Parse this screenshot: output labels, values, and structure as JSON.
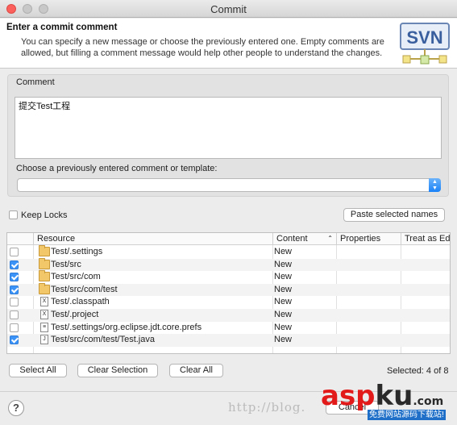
{
  "window": {
    "title": "Commit"
  },
  "header": {
    "title": "Enter a commit comment",
    "description": "You can specify a new message or choose the previously entered one. Empty comments are allowed, but filling a comment message would help other people to understand the changes.",
    "logo_text": "SVN"
  },
  "comment": {
    "label": "Comment",
    "value": "提交Test工程",
    "template_label": "Choose a previously entered comment or template:",
    "template_value": ""
  },
  "options": {
    "keep_locks_label": "Keep Locks",
    "keep_locks_checked": false,
    "paste_button": "Paste selected names"
  },
  "table": {
    "columns": [
      "Resource",
      "Content",
      "Properties",
      "Treat as Edit"
    ],
    "rows": [
      {
        "checked": false,
        "icon": "folder-icon",
        "resource": "Test/.settings",
        "content": "New"
      },
      {
        "checked": true,
        "icon": "folder-icon",
        "resource": "Test/src",
        "content": "New"
      },
      {
        "checked": true,
        "icon": "folder-icon",
        "resource": "Test/src/com",
        "content": "New"
      },
      {
        "checked": true,
        "icon": "folder-icon",
        "resource": "Test/src/com/test",
        "content": "New"
      },
      {
        "checked": false,
        "icon": "xml-file-icon",
        "resource": "Test/.classpath",
        "content": "New"
      },
      {
        "checked": false,
        "icon": "xml-file-icon",
        "resource": "Test/.project",
        "content": "New"
      },
      {
        "checked": false,
        "icon": "text-file-icon",
        "resource": "Test/.settings/org.eclipse.jdt.core.prefs",
        "content": "New"
      },
      {
        "checked": true,
        "icon": "java-file-icon",
        "resource": "Test/src/com/test/Test.java",
        "content": "New"
      }
    ]
  },
  "footer": {
    "select_all": "Select All",
    "clear_selection": "Clear Selection",
    "clear_all": "Clear All",
    "selected_count": "Selected: 4 of 8",
    "help": "?",
    "cancel": "Cancel"
  },
  "watermark": {
    "url": "http://blog.",
    "brand_red": "asp",
    "brand_dark": "ku",
    "brand_suffix": ".com",
    "tagline": "免费网站源码下载站!"
  },
  "colors": {
    "accent": "#3b93f7",
    "close": "#fc605c"
  }
}
